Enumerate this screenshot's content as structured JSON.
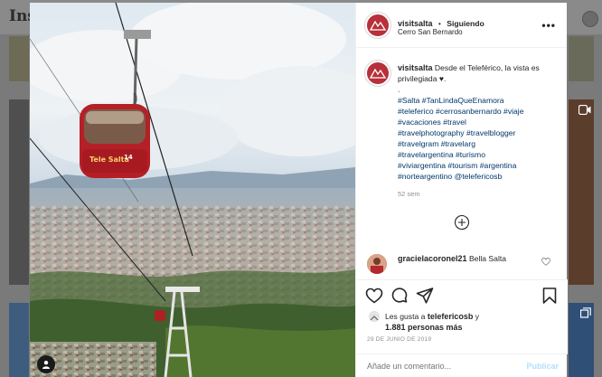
{
  "background": {
    "logo_text": "Inst"
  },
  "post": {
    "username": "visitsalta",
    "follow_separator": "•",
    "follow_label": "Siguiendo",
    "location": "Cerro San Bernardo",
    "more_icon": "more-horizontal-icon",
    "caption_text": "Desde el Teleférico, la vista es privilegiada ♥.",
    "caption_dot": ".",
    "hashtags_lines": [
      "#Salta #TanLindaQueEnamora",
      "#teleferico #cerrosanbernardo #viaje",
      "#vacaciones #travel",
      "#travelphotography #travelblogger",
      "#travelgram #travelarg",
      "#travelargentina #turismo",
      "#viviargentina #tourism #argentina",
      "#norteargentino @telefericosb"
    ],
    "caption_age": "52 sem",
    "comment": {
      "username": "gracielacoronel21",
      "text": "Bella Salta"
    },
    "likes": {
      "prefix": "Les gusta a ",
      "liker": "telefericosb",
      "suffix": " y",
      "others": "1.881 personas más"
    },
    "date": "29 DE JUNIO DE 2019",
    "comment_placeholder": "Añade un comentario...",
    "publish_label": "Publicar"
  },
  "photo": {
    "cable_car_text": "Tele Salta",
    "cable_car_number": "14"
  },
  "colors": {
    "accent": "#0095f6",
    "brand_red": "#b7303a"
  }
}
